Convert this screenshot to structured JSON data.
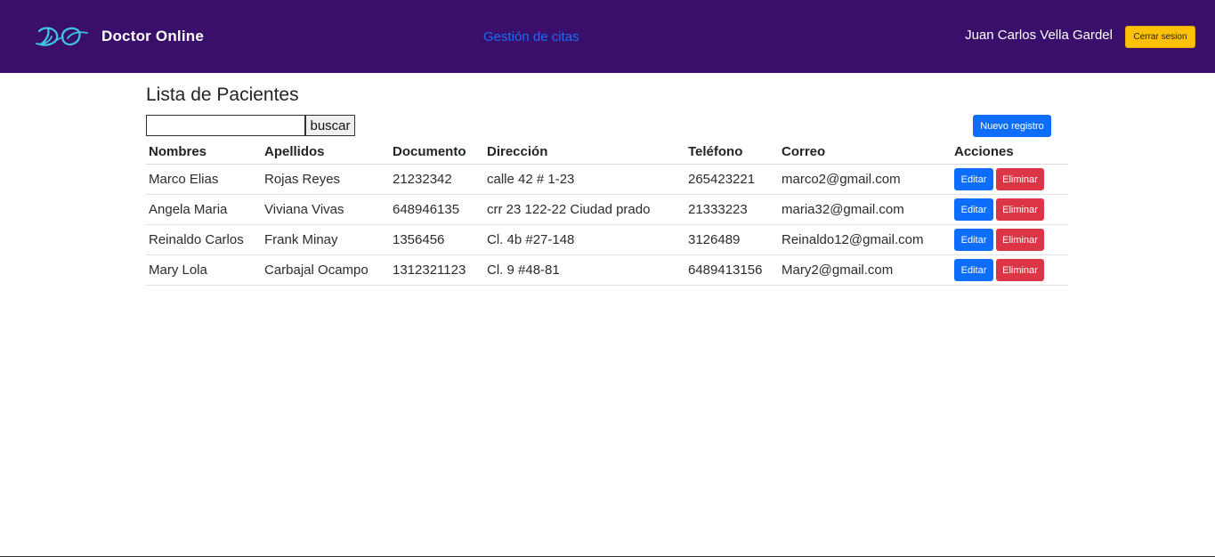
{
  "navbar": {
    "brand_name": "Doctor Online",
    "logo_icon": "do-monogram-logo",
    "nav_link": "Gestión de citas",
    "user_name": "Juan Carlos Vella Gardel",
    "logout_label": "Cerrar sesion",
    "background_color": "#3a0f6b",
    "logo_color": "#3fc6e8",
    "link_color": "#1e6cf0"
  },
  "main": {
    "title": "Lista de Pacientes",
    "search": {
      "value": "",
      "placeholder": "",
      "button_label": "buscar"
    },
    "new_button_label": "Nuevo registro",
    "table": {
      "headers": {
        "nombres": "Nombres",
        "apellidos": "Apellidos",
        "documento": "Documento",
        "direccion": "Dirección",
        "telefono": "Teléfono",
        "correo": "Correo",
        "acciones": "Acciones"
      },
      "rows": [
        {
          "nombres": "Marco Elias",
          "apellidos": "Rojas Reyes",
          "documento": "21232342",
          "direccion": "calle 42 # 1-23",
          "telefono": "265423221",
          "correo": "marco2@gmail.com",
          "edit_label": "Editar",
          "delete_label": "Eliminar"
        },
        {
          "nombres": "Angela Maria",
          "apellidos": "Viviana Vivas",
          "documento": "648946135",
          "direccion": "crr 23 122-22 Ciudad prado",
          "telefono": "21333223",
          "correo": "maria32@gmail.com",
          "edit_label": "Editar",
          "delete_label": "Eliminar"
        },
        {
          "nombres": "Reinaldo Carlos",
          "apellidos": "Frank Minay",
          "documento": "1356456",
          "direccion": "Cl. 4b #27-148",
          "telefono": "3126489",
          "correo": "Reinaldo12@gmail.com",
          "edit_label": "Editar",
          "delete_label": "Eliminar"
        },
        {
          "nombres": "Mary Lola",
          "apellidos": "Carbajal Ocampo",
          "documento": "1312321123",
          "direccion": "Cl. 9 #48-81",
          "telefono": "6489413156",
          "correo": "Mary2@gmail.com",
          "edit_label": "Editar",
          "delete_label": "Eliminar"
        }
      ]
    }
  },
  "colors": {
    "primary": "#0d6efd",
    "danger": "#dc3545",
    "warning": "#ffc107"
  }
}
